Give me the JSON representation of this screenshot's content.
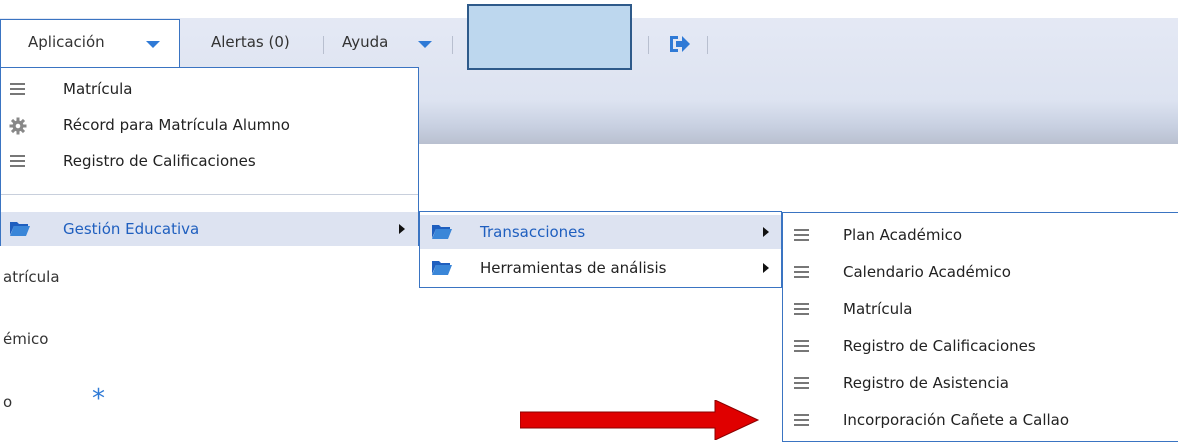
{
  "nav": {
    "aplicacion": "Aplicación",
    "alertas": "Alertas (0)",
    "ayuda": "Ayuda",
    "separator": "|"
  },
  "menu_aplicacion": {
    "items": [
      {
        "label": "Matrícula",
        "icon": "list-icon"
      },
      {
        "label": "Récord para Matrícula Alumno",
        "icon": "gear-icon"
      },
      {
        "label": "Registro de Calificaciones",
        "icon": "list-icon"
      },
      {
        "label": "Gestión Educativa",
        "icon": "folder-icon",
        "submenu": true
      }
    ]
  },
  "menu_gestion": {
    "items": [
      {
        "label": "Transacciones",
        "icon": "folder-icon",
        "submenu": true
      },
      {
        "label": "Herramientas de análisis",
        "icon": "folder-icon",
        "submenu": true
      }
    ]
  },
  "menu_transacciones": {
    "items": [
      {
        "label": "Plan Académico",
        "icon": "list-icon"
      },
      {
        "label": "Calendario Académico",
        "icon": "list-icon"
      },
      {
        "label": "Matrícula",
        "icon": "list-icon"
      },
      {
        "label": "Registro de Calificaciones",
        "icon": "list-icon"
      },
      {
        "label": "Registro de Asistencia",
        "icon": "list-icon"
      },
      {
        "label": "Incorporación Cañete a Callao",
        "icon": "list-icon"
      }
    ]
  },
  "background": {
    "line1": "atrícula",
    "line2": "émico",
    "line3": "o",
    "star": "*"
  },
  "colors": {
    "accent": "#3a74c2",
    "highlight_text": "#1f5fbf",
    "red_arrow": "#e00000"
  }
}
